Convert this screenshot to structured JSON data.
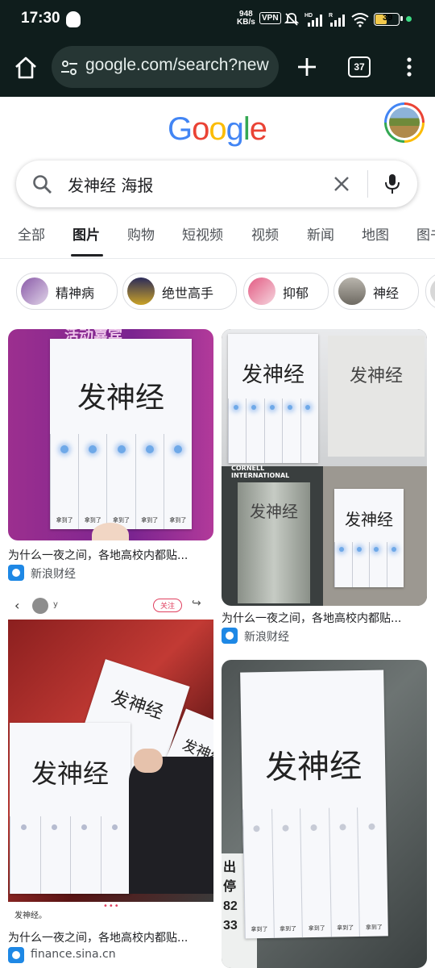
{
  "status": {
    "time": "17:30",
    "net_speed_value": "948",
    "net_speed_unit": "KB/s",
    "vpn": "VPN",
    "hd": "HD",
    "r": "R",
    "battery": "39"
  },
  "browser": {
    "url": "google.com/search?new",
    "tab_count": "37"
  },
  "google": {
    "logo_letters": [
      "G",
      "o",
      "o",
      "g",
      "l",
      "e"
    ],
    "logo_colors": [
      "#4285f4",
      "#ea4335",
      "#fbbc05",
      "#4285f4",
      "#34a853",
      "#ea4335"
    ],
    "query": "发神经 海报"
  },
  "tabs": [
    "全部",
    "图片",
    "购物",
    "短视频",
    "视频",
    "新闻",
    "地图",
    "图书"
  ],
  "active_tab": "图片",
  "chips": [
    "精神病",
    "绝世高手",
    "抑郁",
    "神经"
  ],
  "results": [
    {
      "poster_title": "发神经",
      "strip_label": "拿到了",
      "caption": "为什么一夜之间，各地高校内都贴...",
      "source": "新浪财经",
      "banner_text": "活动嘉宾"
    },
    {
      "poster_title": "发神经",
      "strip_label": "拿到了",
      "caption": "为什么一夜之间，各地高校内都贴...",
      "source": "新浪财经",
      "sign_text": "CORNELL INTERNATIONAL"
    },
    {
      "poster_title": "发神经",
      "strip_label": "拿到了",
      "caption": "为什么一夜之间，各地高校内都贴...",
      "source": "finance.sina.cn",
      "app_user": "y",
      "follow_label": "关注",
      "post_text": "发神经。"
    },
    {
      "poster_title": "发神经",
      "strip_label": "拿到了",
      "door_text": "出\n停\n82\n33"
    }
  ],
  "colors": {
    "status_bg": "#0f1d1c",
    "url_bg": "#263634"
  }
}
